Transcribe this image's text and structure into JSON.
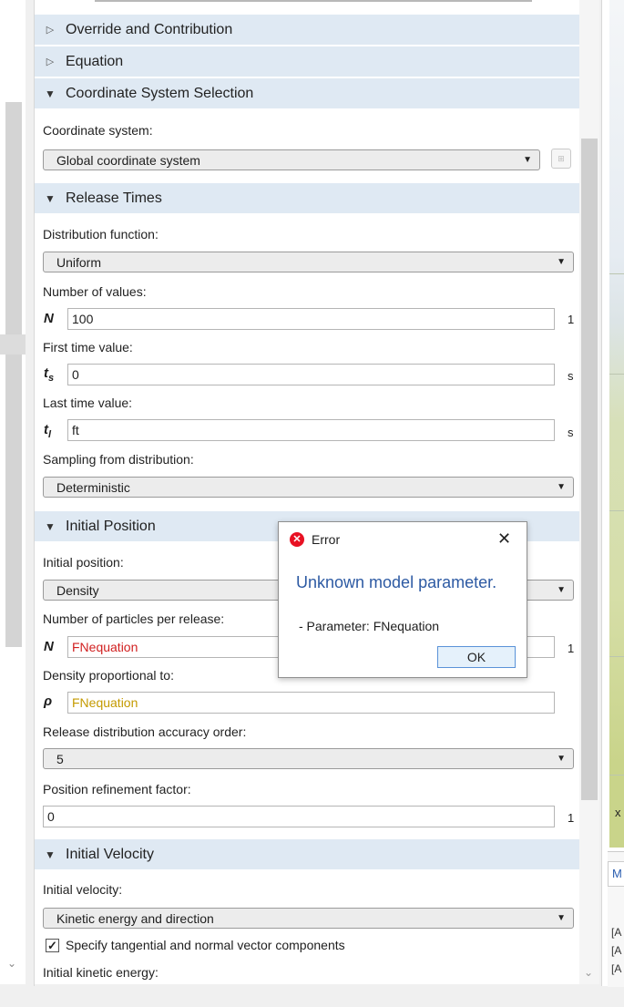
{
  "sections": {
    "override": "Override and Contribution",
    "equation": "Equation",
    "coordinate": "Coordinate System Selection",
    "release": "Release Times",
    "position": "Initial Position",
    "velocity": "Initial Velocity"
  },
  "coordinate_system": {
    "label": "Coordinate system:",
    "value": "Global coordinate system"
  },
  "release_times": {
    "distribution_label": "Distribution function:",
    "distribution_value": "Uniform",
    "num_values_label": "Number of values:",
    "num_values_symbol": "N",
    "num_values": "100",
    "num_values_unit": "1",
    "first_label": "First time value:",
    "first_symbol": "ts",
    "first_value": "0",
    "first_unit": "s",
    "last_label": "Last time value:",
    "last_symbol": "tl",
    "last_value": "ft",
    "last_unit": "s",
    "sampling_label": "Sampling from distribution:",
    "sampling_value": "Deterministic"
  },
  "initial_position": {
    "position_label": "Initial position:",
    "position_value": "Density",
    "particles_label": "Number of particles per release:",
    "particles_symbol": "N",
    "particles_value": "FNequation",
    "particles_unit": "1",
    "density_label": "Density proportional to:",
    "density_symbol": "ρ",
    "density_value": "FNequation",
    "accuracy_label": "Release distribution accuracy order:",
    "accuracy_value": "5",
    "refinement_label": "Position refinement factor:",
    "refinement_value": "0",
    "refinement_unit": "1"
  },
  "initial_velocity": {
    "velocity_label": "Initial velocity:",
    "velocity_value": "Kinetic energy and direction",
    "checkbox_label": "Specify tangential and normal vector components",
    "checkbox_checked": true,
    "energy_label": "Initial kinetic energy:"
  },
  "dialog": {
    "title": "Error",
    "message": "Unknown model parameter.",
    "detail": "- Parameter: FNequation",
    "ok_label": "OK"
  },
  "right_panel": {
    "axis_label": "x",
    "tab_label": "M",
    "lines": [
      "[A",
      "[A",
      "[A"
    ]
  }
}
